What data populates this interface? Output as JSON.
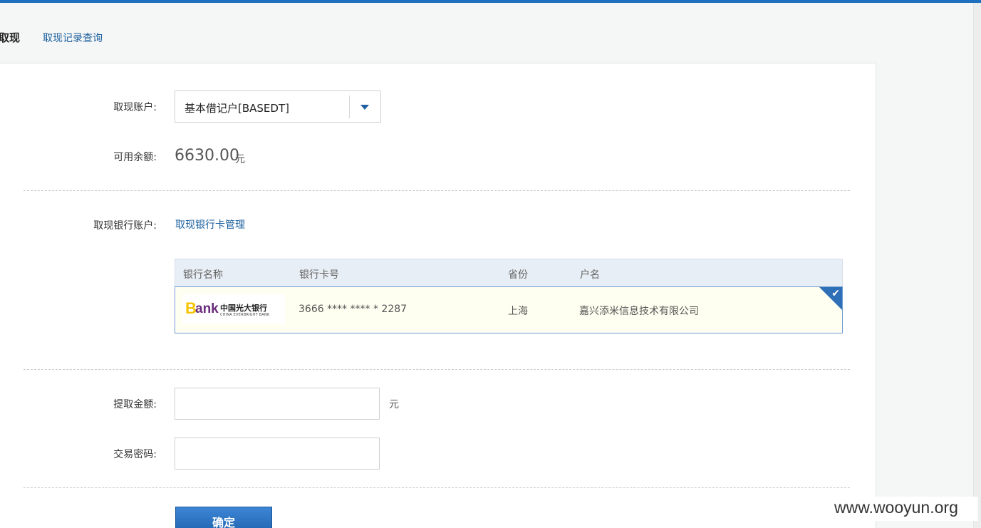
{
  "tabs": {
    "active": "取现",
    "history_link": "取现记录查询"
  },
  "account": {
    "label": "取现账户:",
    "selected": "基本借记户[BASEDT]"
  },
  "balance": {
    "label": "可用余额:",
    "amount": "6630.00",
    "unit": "元"
  },
  "bank_account": {
    "label": "取现银行账户:",
    "manage_link": "取现银行卡管理",
    "headers": [
      "银行名称",
      "银行卡号",
      "省份",
      "户名"
    ],
    "rows": [
      {
        "logo_b": "B",
        "logo_ank": "ank",
        "logo_cn": "中国光大银行",
        "logo_en": "CHINA EVERBRIGHT BANK",
        "card_number": "3666 **** **** * 2287",
        "province": "上海",
        "holder": "嘉兴添米信息技术有限公司",
        "selected": true
      }
    ]
  },
  "withdraw": {
    "amount_label": "提取金额:",
    "amount_value": "",
    "unit": "元",
    "password_label": "交易密码:",
    "password_value": ""
  },
  "submit_label": "确定",
  "watermark": "www.wooyun.org",
  "colors": {
    "accent": "#1f6fbf",
    "link": "#1a5f9e",
    "selected_row_bg": "#fffff1"
  },
  "icons": {
    "dropdown": "caret-down-icon",
    "selected": "check-icon"
  }
}
